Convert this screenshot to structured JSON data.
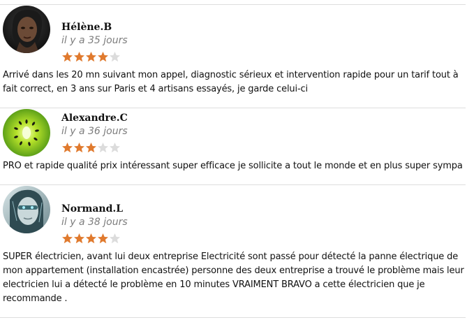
{
  "colors": {
    "star_filled": "#e07a2e",
    "star_empty": "#dcdcdc",
    "divider": "#dedede",
    "date_text": "#7d7d7d"
  },
  "reviews": [
    {
      "author": "Hélène.B",
      "date": "il y a 35 jours",
      "rating": 4,
      "rating_max": 5,
      "avatar_icon": "portrait-woman-avatar-icon",
      "text": "Arrivé dans les 20 mn suivant mon appel, diagnostic sérieux et intervention rapide pour un tarif tout à fait correct, en 3 ans sur Paris et 4 artisans essayés, je garde celui-ci"
    },
    {
      "author": "Alexandre.C",
      "date": "il y a 36 jours",
      "rating": 3,
      "rating_max": 5,
      "avatar_icon": "kiwi-avatar-icon",
      "text": "PRO et rapide qualité prix intéressant super efficace je sollicite a tout le monde et en plus super sympa"
    },
    {
      "author": "Normand.L",
      "date": "il y a 38 jours",
      "rating": 4,
      "rating_max": 5,
      "avatar_icon": "portrait-cyborg-avatar-icon",
      "text": "SUPER électricien, avant lui deux entreprise Electricité sont passé pour détecté la panne électrique de mon appartement (installation encastrée) personne des deux entreprise a trouvé le problème mais leur electricien lui a détecté le problème en 10 minutes VRAIMENT  BRAVO a cette électricien que je recommande ."
    }
  ]
}
